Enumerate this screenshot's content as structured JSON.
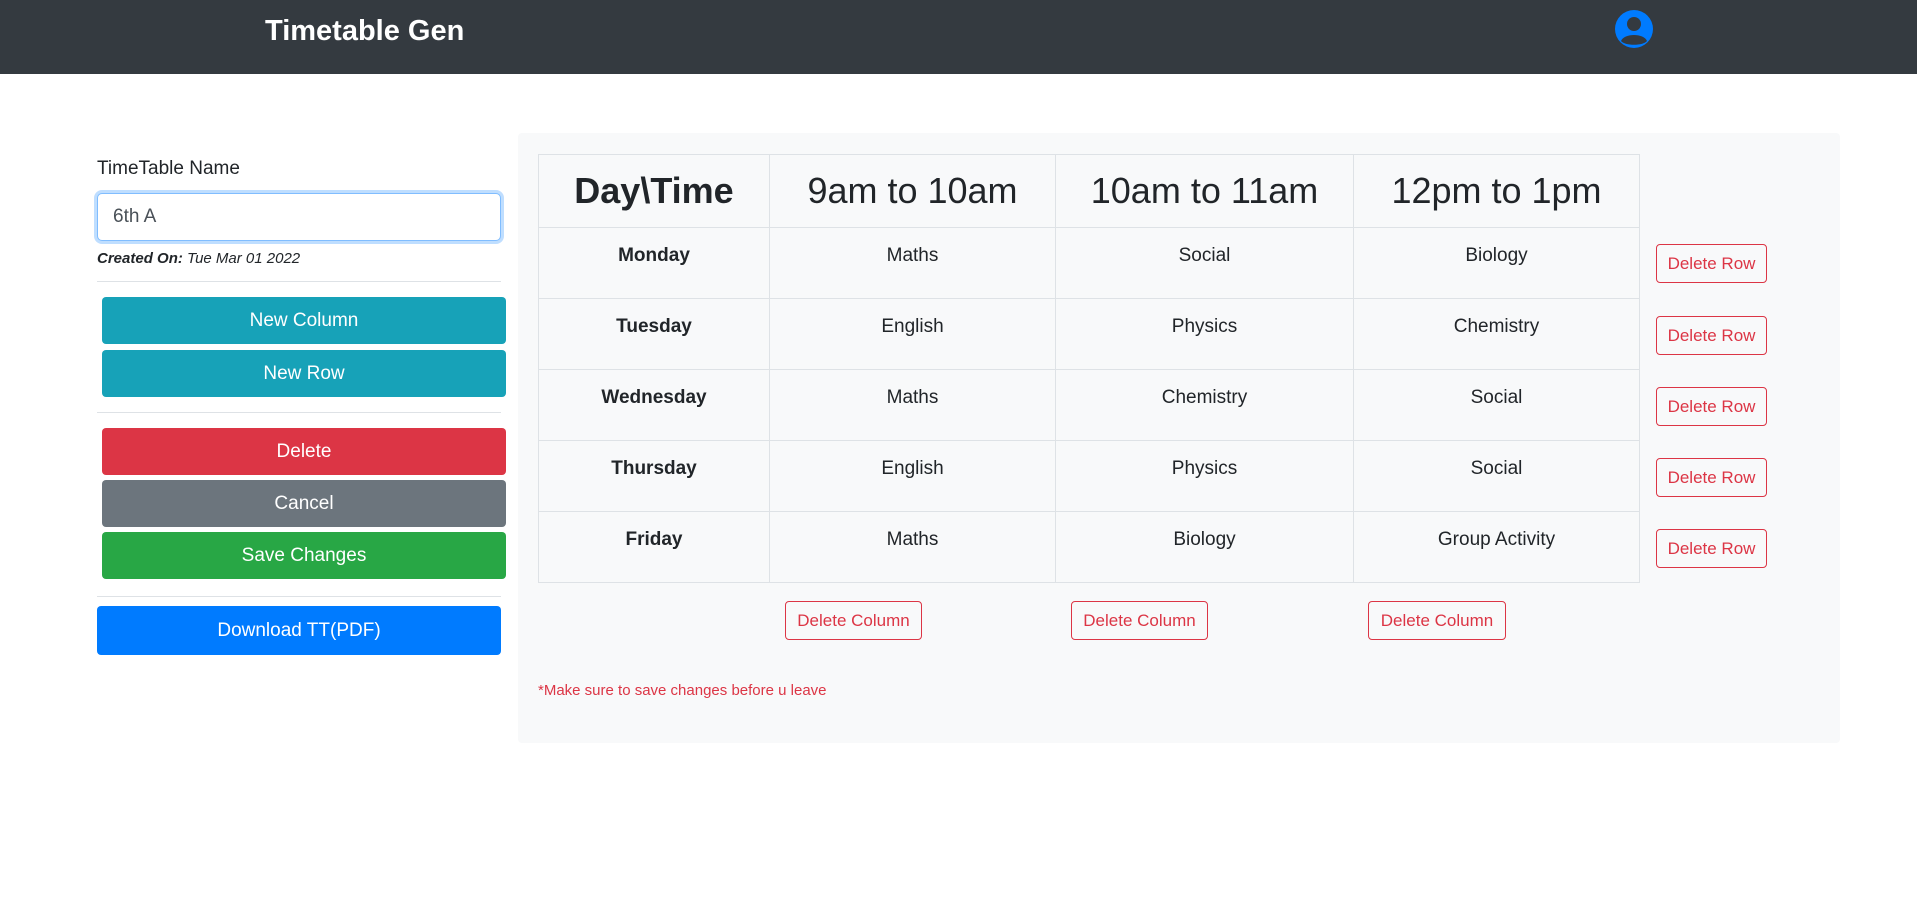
{
  "navbar": {
    "brand": "Timetable Gen",
    "avatar_icon": "user-circle-icon"
  },
  "sidebar": {
    "name_label": "TimeTable Name",
    "name_value": "6th A",
    "created_label": "Created On:",
    "created_date": "Tue Mar 01 2022",
    "new_column_label": "New Column",
    "new_row_label": "New Row",
    "delete_label": "Delete",
    "cancel_label": "Cancel",
    "save_label": "Save Changes",
    "download_label": "Download TT(PDF)"
  },
  "timetable": {
    "corner_header": "Day\\Time",
    "columns": [
      "9am to 10am",
      "10am to 11am",
      "12pm to 1pm"
    ],
    "rows": [
      {
        "day": "Monday",
        "cells": [
          "Maths",
          "Social",
          "Biology"
        ]
      },
      {
        "day": "Tuesday",
        "cells": [
          "English",
          "Physics",
          "Chemistry"
        ]
      },
      {
        "day": "Wednesday",
        "cells": [
          "Maths",
          "Chemistry",
          "Social"
        ]
      },
      {
        "day": "Thursday",
        "cells": [
          "English",
          "Physics",
          "Social"
        ]
      },
      {
        "day": "Friday",
        "cells": [
          "Maths",
          "Biology",
          "Group Activity"
        ]
      }
    ],
    "delete_row_label": "Delete Row",
    "delete_column_label": "Delete Column",
    "note": "*Make sure to save changes before u leave"
  },
  "colors": {
    "navbar": "#343a40",
    "info": "#17a2b8",
    "danger": "#dc3545",
    "secondary": "#6c757d",
    "success": "#28a745",
    "primary": "#007bff"
  }
}
